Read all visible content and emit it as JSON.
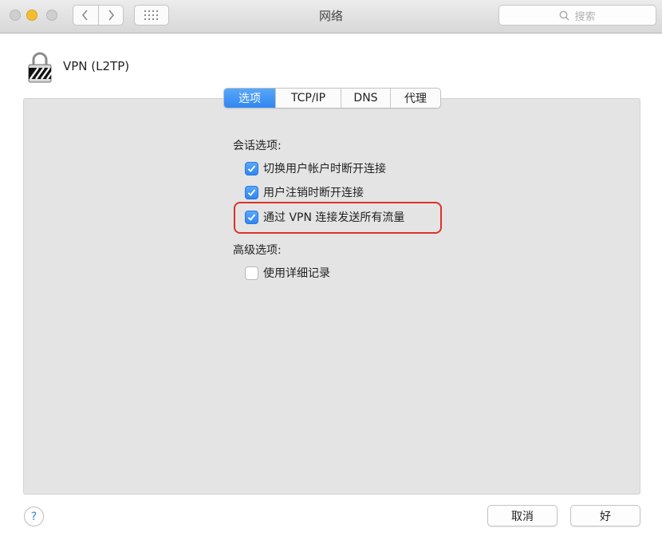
{
  "window": {
    "title": "网络"
  },
  "toolbar": {
    "search_placeholder": "搜索",
    "back_icon": "chevron-left-icon",
    "forward_icon": "chevron-right-icon",
    "grid_icon": "grid-icon"
  },
  "header": {
    "vpn_name": "VPN (L2TP)",
    "icon": "lock-icon"
  },
  "tabs": [
    {
      "label": "选项",
      "active": true
    },
    {
      "label": "TCP/IP",
      "active": false
    },
    {
      "label": "DNS",
      "active": false
    },
    {
      "label": "代理",
      "active": false
    }
  ],
  "session_options": {
    "title": "会话选项:",
    "items": [
      {
        "label": "切换用户帐户时断开连接",
        "checked": true
      },
      {
        "label": "用户注销时断开连接",
        "checked": true
      },
      {
        "label": "通过 VPN 连接发送所有流量",
        "checked": true
      }
    ]
  },
  "advanced_options": {
    "title": "高级选项:",
    "items": [
      {
        "label": "使用详细记录",
        "checked": false
      }
    ]
  },
  "footer": {
    "help_label": "?",
    "cancel_label": "取消",
    "ok_label": "好"
  },
  "colors": {
    "accent": "#2f86f2",
    "highlight_border": "#d9342a",
    "panel_bg": "#e4e4e4"
  }
}
